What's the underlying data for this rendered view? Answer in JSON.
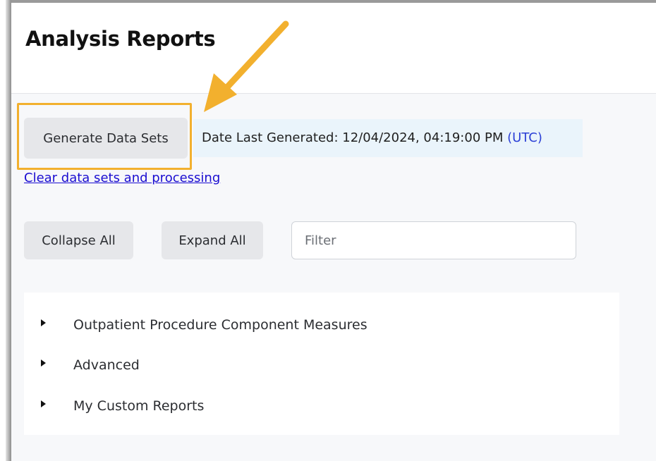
{
  "page": {
    "title": "Analysis Reports"
  },
  "toolbar": {
    "generate_label": "Generate Data Sets",
    "date_label": "Date Last Generated: 12/04/2024, 04:19:00 PM",
    "timezone": "(UTC)",
    "clear_link": "Clear data sets and processing"
  },
  "controls": {
    "collapse_label": "Collapse All",
    "expand_label": "Expand All",
    "filter_placeholder": "Filter",
    "filter_value": ""
  },
  "tree": {
    "items": [
      {
        "label": "Outpatient Procedure Component Measures",
        "icon": "caret-right-icon"
      },
      {
        "label": "Advanced",
        "icon": "caret-right-icon"
      },
      {
        "label": "My Custom Reports",
        "icon": "caret-right-icon"
      }
    ]
  },
  "colors": {
    "annotation_orange": "#f2b02e",
    "link_blue": "#1a0dd1",
    "date_background": "#eaf4fb"
  }
}
